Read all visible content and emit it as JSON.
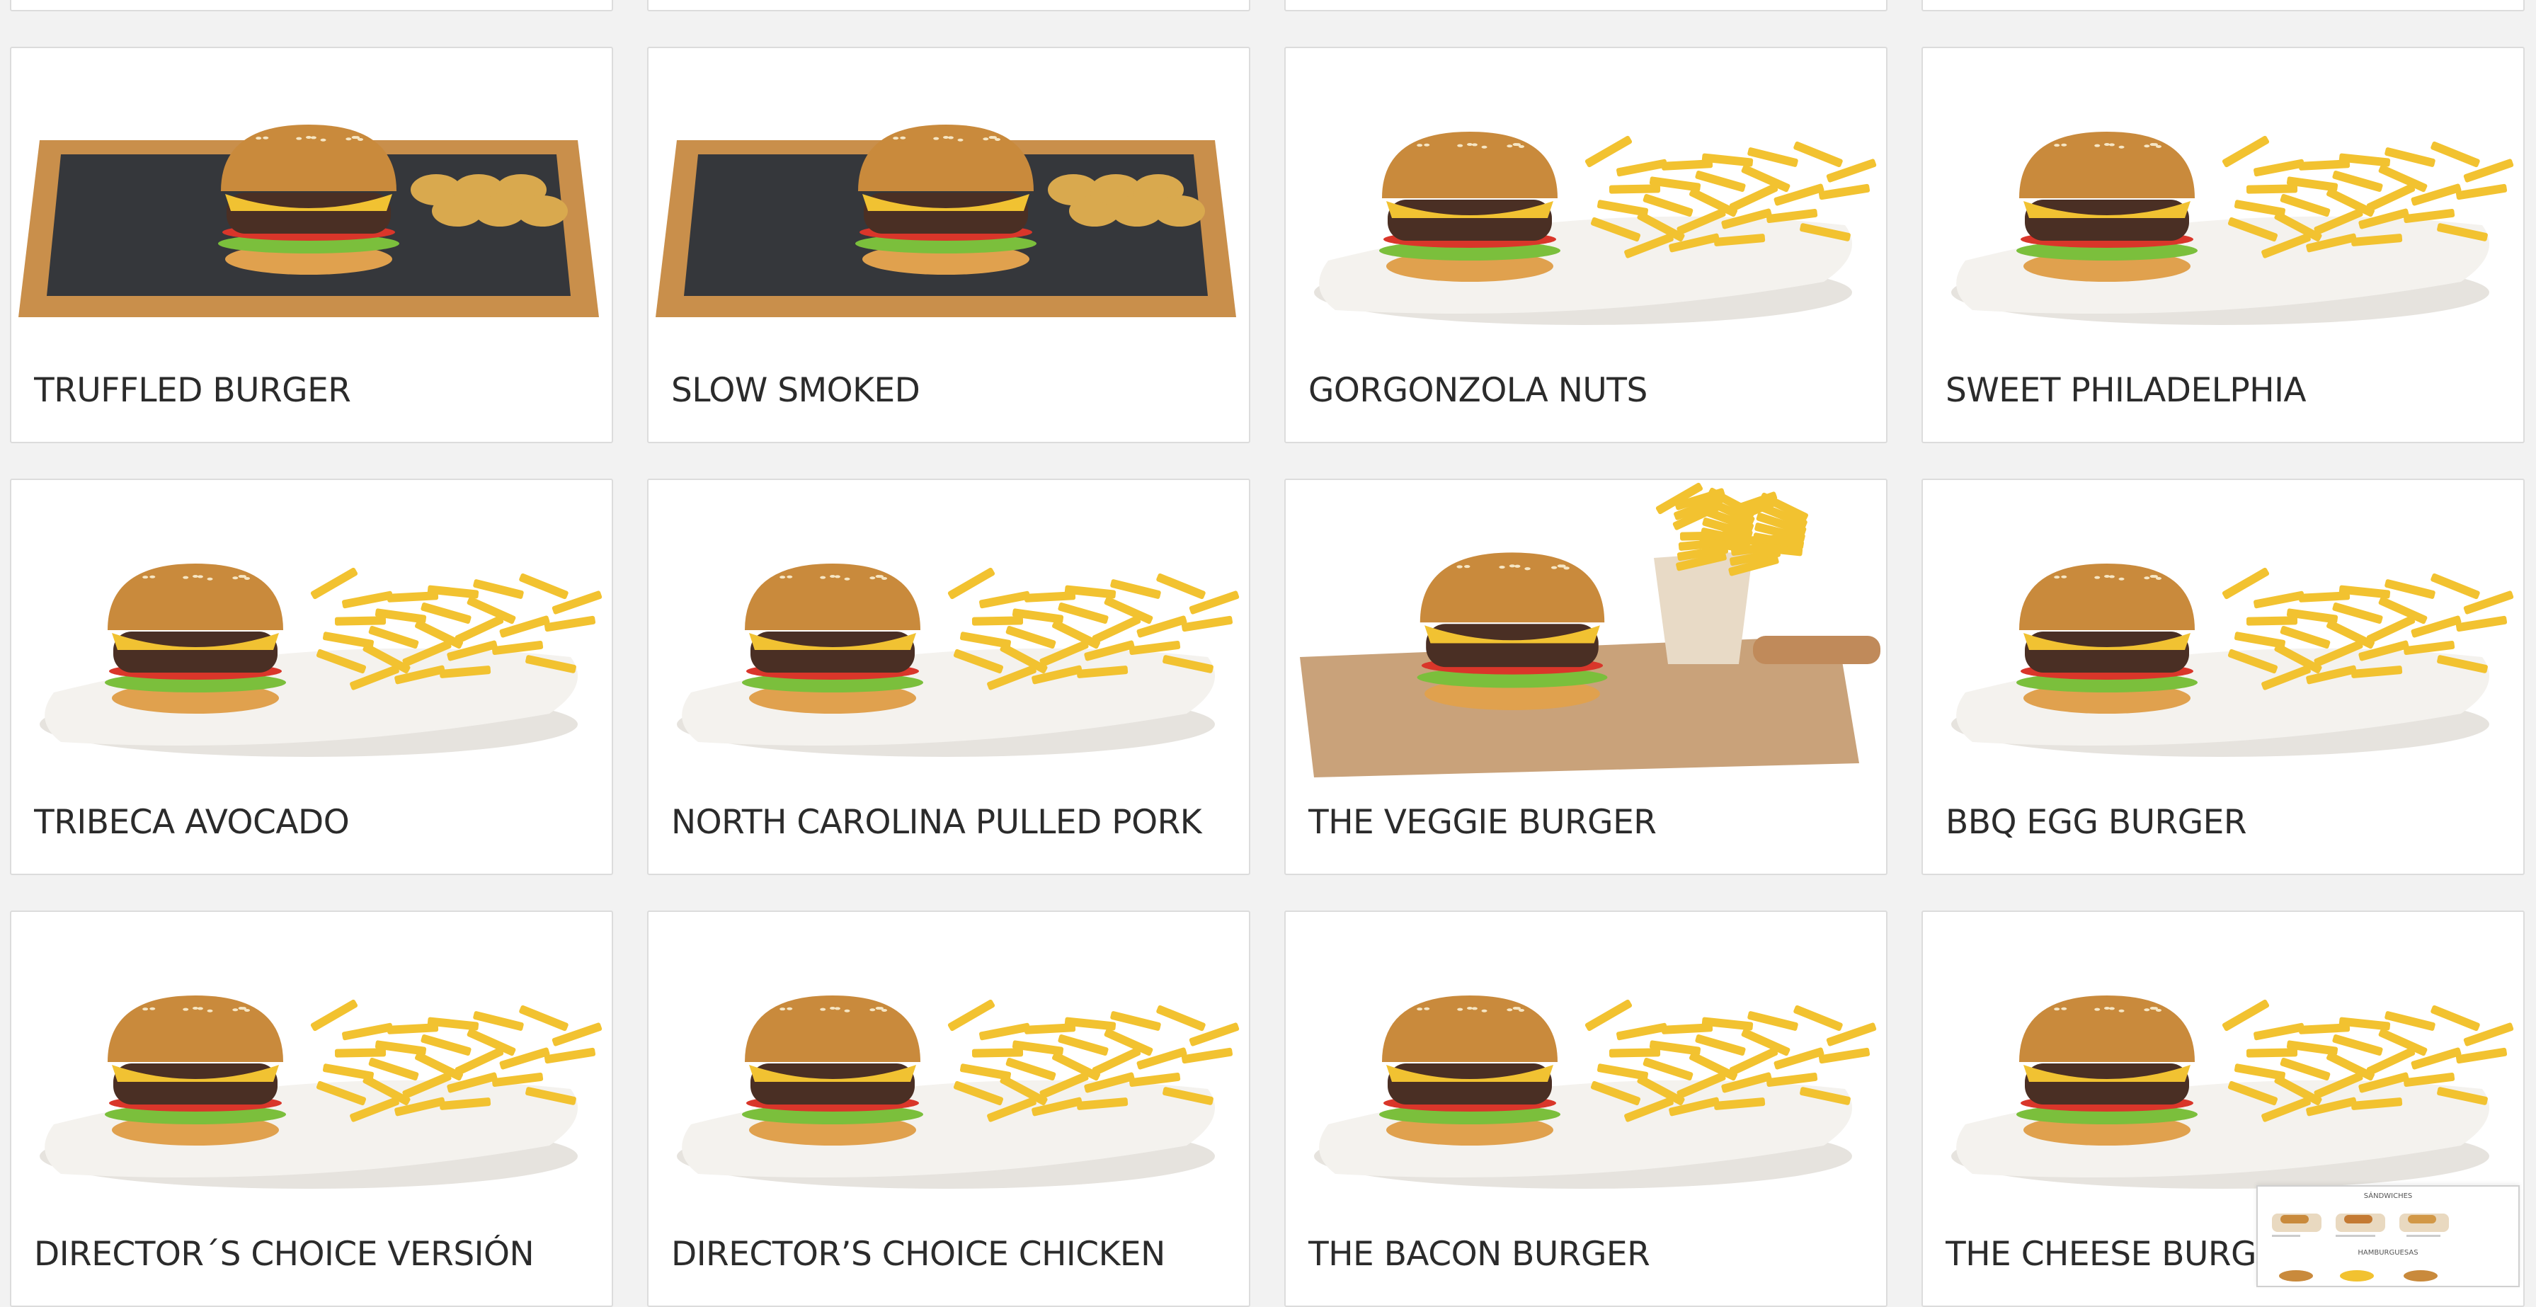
{
  "menu_items": [
    {
      "name": "TRUFFLED BURGER",
      "image": "truffled-burger-slate-board",
      "board": "bamboo",
      "side": "potato-wedges"
    },
    {
      "name": "SLOW SMOKED",
      "image": "slow-smoked-slate-board",
      "board": "bamboo",
      "side": "potato-wedges"
    },
    {
      "name": "GORGONZOLA NUTS",
      "image": "gorgonzola-nuts-plate",
      "board": "plate",
      "side": "fries"
    },
    {
      "name": "SWEET PHILADELPHIA",
      "image": "sweet-philadelphia-plate",
      "board": "plate",
      "side": "fries"
    },
    {
      "name": "TRIBECA AVOCADO",
      "image": "tribeca-avocado-plate",
      "board": "plate",
      "side": "fries"
    },
    {
      "name": "NORTH CAROLINA PULLED PORK",
      "image": "north-carolina-pulled-pork-plate",
      "board": "plate",
      "side": "fries"
    },
    {
      "name": "THE VEGGIE BURGER",
      "image": "veggie-burger-wooden-board",
      "board": "wood",
      "side": "fries-cone"
    },
    {
      "name": "BBQ EGG BURGER",
      "image": "bbq-egg-burger-plate",
      "board": "plate",
      "side": "fries"
    },
    {
      "name": "DIRECTOR´S CHOICE VERSIÓN",
      "image": "directors-choice-plate",
      "board": "plate",
      "side": "fries"
    },
    {
      "name": "DIRECTOR’S CHOICE CHICKEN",
      "image": "directors-choice-chicken-plate",
      "board": "plate",
      "side": "fries"
    },
    {
      "name": "THE BACON BURGER",
      "image": "bacon-burger-plate",
      "board": "plate",
      "side": "fries"
    },
    {
      "name": "THE CHEESE BURGER",
      "image": "cheese-burger-plate",
      "board": "plate",
      "side": "fries"
    }
  ],
  "mini_menu_preview": {
    "section_1": "SÁNDWICHES",
    "section_2": "HAMBURGUESAS"
  },
  "colors": {
    "page_bg": "#f2f2f2",
    "card_bg": "#ffffff",
    "card_border": "#dcdcdc",
    "title_text": "#2b2b2b",
    "bun": "#c98a3c",
    "patty": "#4a2f24",
    "fries": "#f2c230",
    "plate": "#f4f2ee",
    "slate": "#35373b",
    "bamboo": "#c98f4b"
  }
}
